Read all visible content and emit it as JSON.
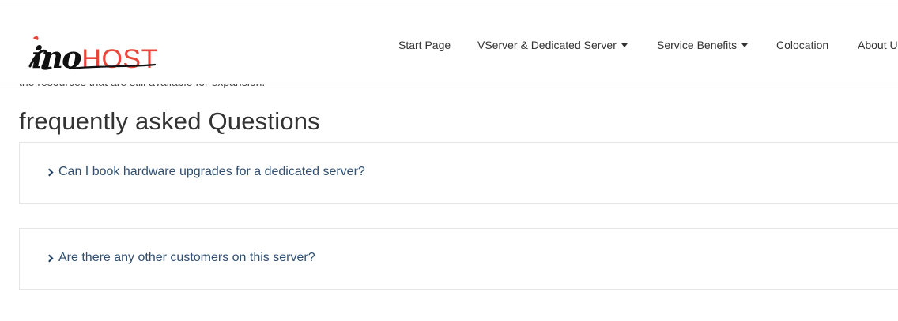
{
  "page": {
    "clipped_text": "the resources that are still available for expansion."
  },
  "header": {
    "logo": {
      "script_text": "ino",
      "brand_text": "HOST",
      "brand_color": "#e8463a"
    },
    "nav": [
      {
        "label": "Start Page",
        "dropdown": false
      },
      {
        "label": "VServer & Dedicated Server",
        "dropdown": true
      },
      {
        "label": "Service Benefits",
        "dropdown": true
      },
      {
        "label": "Colocation",
        "dropdown": false
      },
      {
        "label": "About U",
        "dropdown": false
      }
    ]
  },
  "faq": {
    "title": "frequently asked Questions",
    "items": [
      {
        "question": "Can I book hardware upgrades for a dedicated server?"
      },
      {
        "question": "Are there any other customers on this server?"
      }
    ]
  },
  "colors": {
    "question_text": "#2f4f73",
    "chevron": "#1f3e62",
    "border": "#e6e6e6"
  }
}
